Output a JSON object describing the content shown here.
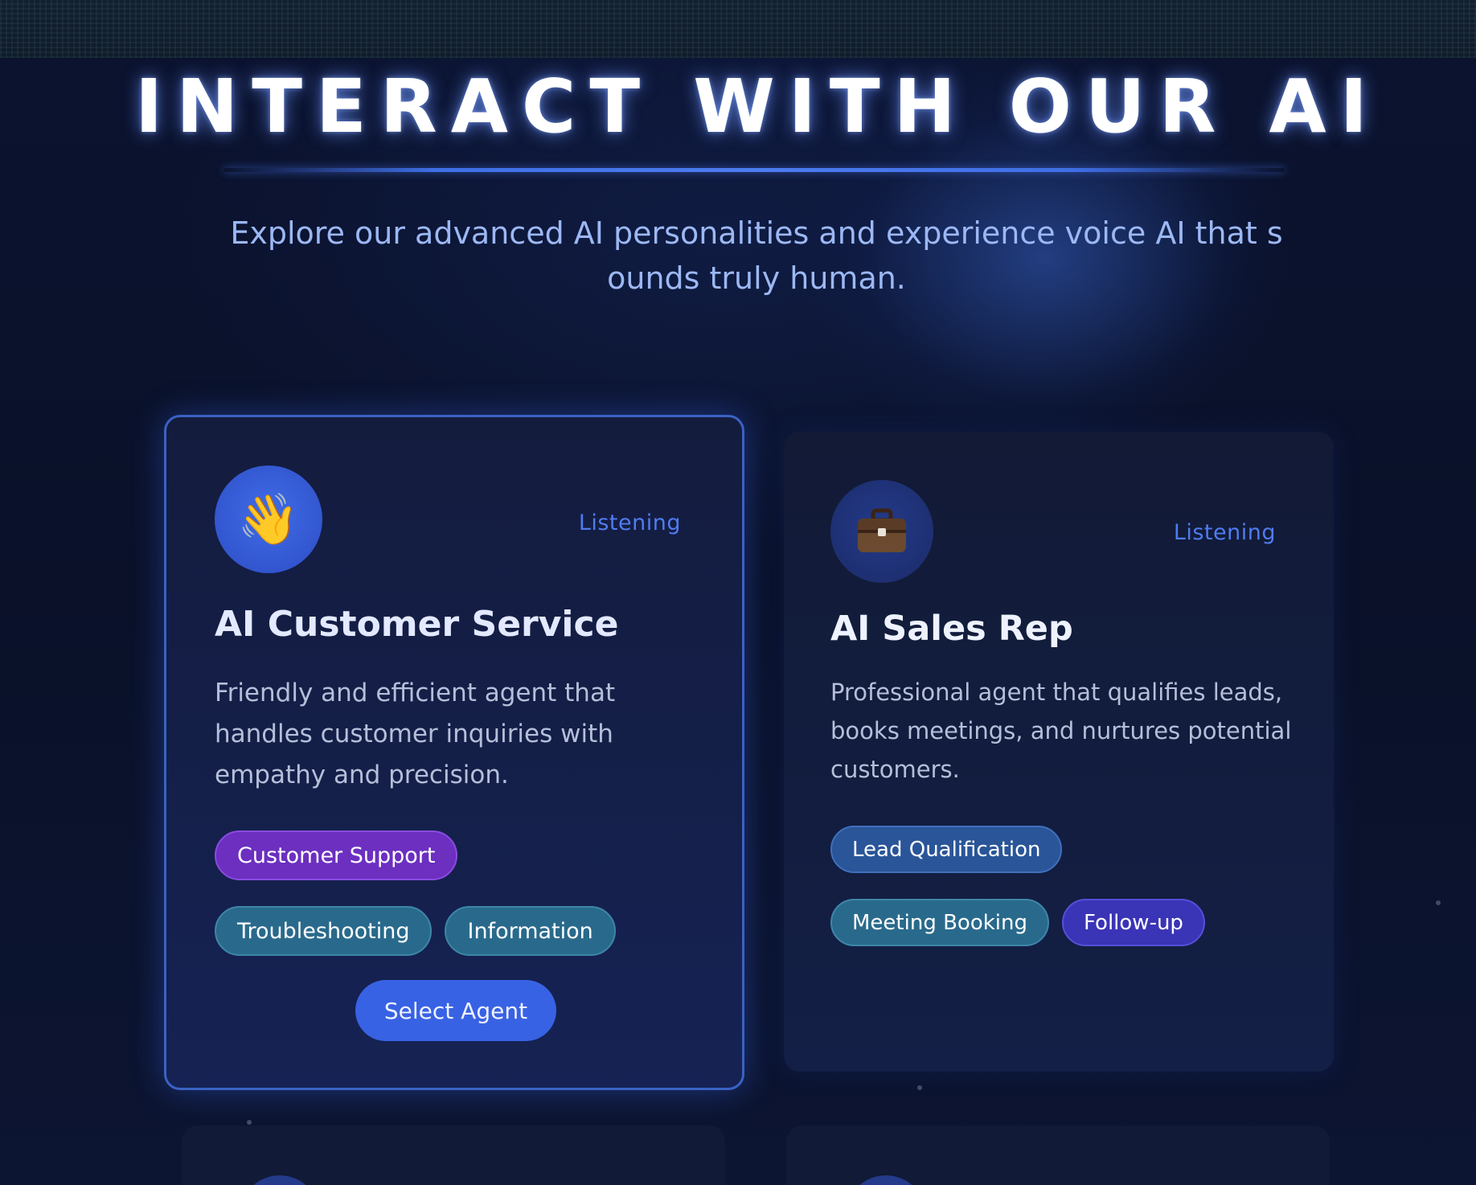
{
  "hero": {
    "title": "INTERACT WITH OUR AI",
    "subtitle": "Explore our advanced AI personalities and experience voice AI that sounds truly human."
  },
  "agents": [
    {
      "icon": "waving-hand-icon",
      "emoji": "👋",
      "status": "Listening",
      "title": "AI Customer Service",
      "description": "Friendly and efficient agent that handles customer inquiries with empathy and precision.",
      "tags": [
        "Customer Support",
        "Troubleshooting",
        "Information"
      ],
      "select_label": "Select Agent"
    },
    {
      "icon": "briefcase-icon",
      "status": "Listening",
      "title": "AI Sales Rep",
      "description": "Professional agent that qualifies leads, books meetings, and nurtures potential customers.",
      "tags": [
        "Lead Qualification",
        "Meeting Booking",
        "Follow-up"
      ]
    }
  ],
  "colors": {
    "background": "#0a1127",
    "accent": "#3862e4",
    "status_text": "#4f7cf0",
    "tag_purple": "#6c2fc0",
    "tag_teal": "#296a8c",
    "tag_blue": "#2a5598",
    "tag_indigo": "#3a34b6"
  }
}
